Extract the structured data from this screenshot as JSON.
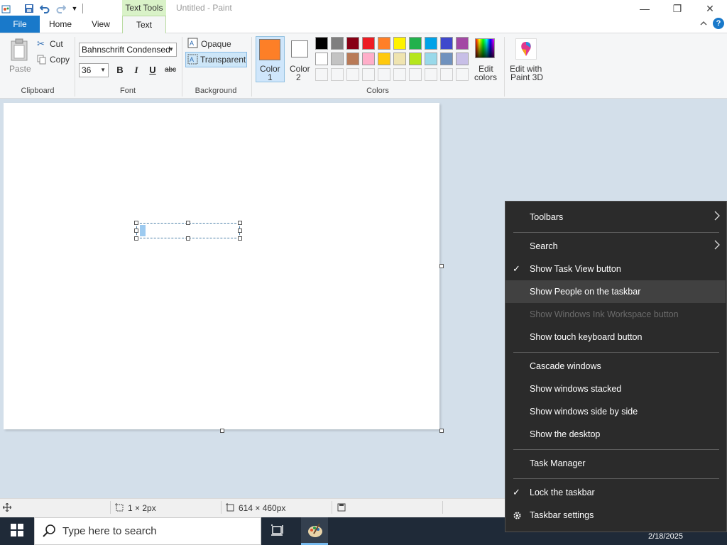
{
  "window": {
    "title": "Untitled - Paint",
    "contextual_tab": "Text Tools",
    "minimize_glyph": "—",
    "restore_glyph": "❐",
    "close_glyph": "✕"
  },
  "tabs": {
    "file": "File",
    "home": "Home",
    "view": "View",
    "text": "Text"
  },
  "clipboard": {
    "paste": "Paste",
    "cut": "Cut",
    "copy": "Copy",
    "group": "Clipboard"
  },
  "font": {
    "family": "Bahnschrift Condensed",
    "size": "36",
    "bold": "B",
    "italic": "I",
    "underline": "U",
    "strike": "abc",
    "group": "Font"
  },
  "background": {
    "opaque": "Opaque",
    "transparent": "Transparent",
    "group": "Background"
  },
  "colors": {
    "color1_line1": "Color",
    "color1_line2": "1",
    "color2_line1": "Color",
    "color2_line2": "2",
    "edit_line1": "Edit",
    "edit_line2": "colors",
    "group": "Colors",
    "color1_value": "#fd7f27",
    "color2_value": "#ffffff",
    "palette_row1": [
      "#000000",
      "#7f7f7f",
      "#880015",
      "#ed1c24",
      "#ff7f27",
      "#fff200",
      "#22b14c",
      "#00a2e8",
      "#3f48cc",
      "#a349a4"
    ],
    "palette_row2": [
      "#ffffff",
      "#c3c3c3",
      "#b97a57",
      "#ffaec9",
      "#ffc90e",
      "#efe4b0",
      "#b5e61d",
      "#99d9ea",
      "#7092be",
      "#c8bfe7"
    ]
  },
  "paint3d": {
    "line1": "Edit with",
    "line2": "Paint 3D"
  },
  "status": {
    "selection": "1 × 2px",
    "canvas_size": "614 × 460px"
  },
  "taskbar": {
    "search_placeholder": "Type here to search",
    "date": "2/18/2025"
  },
  "context_menu": {
    "items": [
      {
        "label": "Toolbars",
        "submenu": true
      },
      {
        "label": "Search",
        "submenu": true
      },
      {
        "label": "Show Task View button",
        "checked": true
      },
      {
        "label": "Show People on the taskbar",
        "highlighted": true
      },
      {
        "label": "Show Windows Ink Workspace button",
        "disabled": true
      },
      {
        "label": "Show touch keyboard button"
      },
      {
        "label": "Cascade windows"
      },
      {
        "label": "Show windows stacked"
      },
      {
        "label": "Show windows side by side"
      },
      {
        "label": "Show the desktop"
      },
      {
        "label": "Task Manager"
      },
      {
        "label": "Lock the taskbar",
        "checked": true
      },
      {
        "label": "Taskbar settings"
      }
    ],
    "check_glyph": "✓",
    "submenu_glyph": "›"
  }
}
